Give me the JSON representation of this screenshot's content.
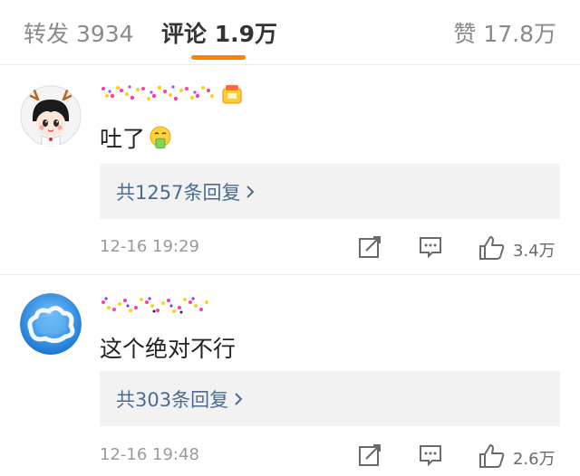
{
  "tabs": {
    "repost": "转发 3934",
    "comments": "评论 1.9万",
    "likes": "赞 17.8万"
  },
  "colors": {
    "accent": "#ff8200",
    "link": "#4a6c92"
  },
  "comments": [
    {
      "text": "吐了",
      "emoji_icon": "vomit-face-emoji",
      "replies_label": "共1257条回复",
      "time": "12-16 19:29",
      "likes": "3.4万"
    },
    {
      "text": "这个绝对不行",
      "replies_label": "共303条回复",
      "time": "12-16 19:48",
      "likes": "2.6万"
    }
  ]
}
